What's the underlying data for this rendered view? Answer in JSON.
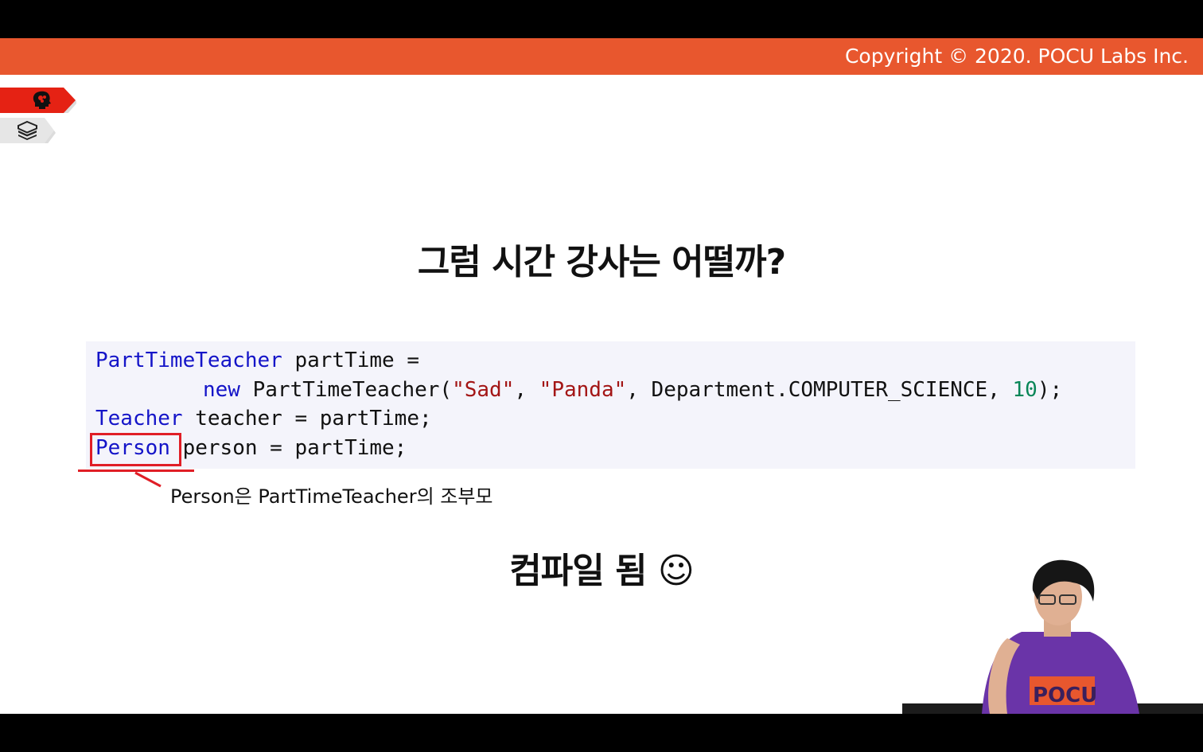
{
  "header": {
    "copyright": "Copyright © 2020. POCU Labs Inc.",
    "accent_color": "#e8572e"
  },
  "side_nav": {
    "tabs": [
      {
        "icon": "brain-head-icon",
        "active": true,
        "color": "#e52214"
      },
      {
        "icon": "books-stack-icon",
        "active": false,
        "color": "#e6e6e6"
      }
    ]
  },
  "slide": {
    "title": "그럼 시간 강사는 어떨까?",
    "code": {
      "line1": {
        "type": "PartTimeTeacher",
        "rest": " partTime ="
      },
      "line2": {
        "keyword": "new",
        "ctor": " PartTimeTeacher(",
        "arg1": "\"Sad\"",
        "sep1": ", ",
        "arg2": "\"Panda\"",
        "sep2": ", Department.COMPUTER_SCIENCE, ",
        "arg4": "10",
        "end": ");"
      },
      "line3": {
        "type": "Teacher",
        "rest": " teacher = partTime;"
      },
      "line4": {
        "type": "Person",
        "rest": " person = partTime;"
      }
    },
    "annotation": "Person은 PartTimeTeacher의 조부모",
    "result": "컴파일 됨 ☺"
  },
  "webcam": {
    "shirt_text": "POCU"
  }
}
